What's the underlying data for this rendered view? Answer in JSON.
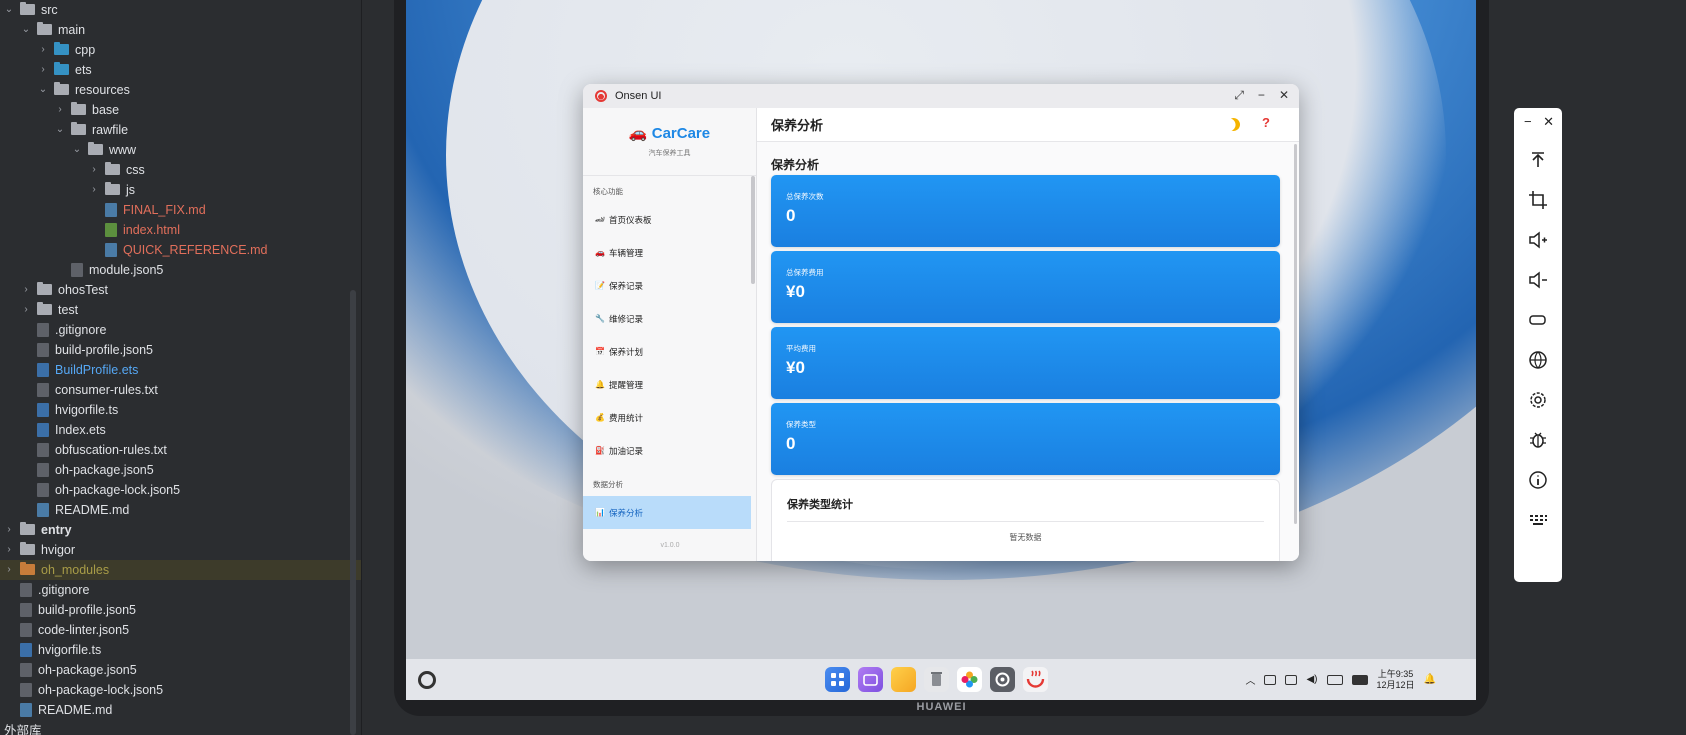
{
  "ide": {
    "tree": [
      {
        "label": "src",
        "type": "folder",
        "depth": 0,
        "open": true
      },
      {
        "label": "main",
        "type": "folder",
        "depth": 1,
        "open": true
      },
      {
        "label": "cpp",
        "type": "folder-blue",
        "depth": 2,
        "open": false
      },
      {
        "label": "ets",
        "type": "folder-blue",
        "depth": 2,
        "open": false
      },
      {
        "label": "resources",
        "type": "folder",
        "depth": 2,
        "open": true
      },
      {
        "label": "base",
        "type": "folder",
        "depth": 3,
        "open": false
      },
      {
        "label": "rawfile",
        "type": "folder",
        "depth": 3,
        "open": true
      },
      {
        "label": "www",
        "type": "folder",
        "depth": 4,
        "open": true
      },
      {
        "label": "css",
        "type": "folder",
        "depth": 5,
        "open": false
      },
      {
        "label": "js",
        "type": "folder",
        "depth": 5,
        "open": false
      },
      {
        "label": "FINAL_FIX.md",
        "type": "file-md",
        "depth": 5,
        "style": "red"
      },
      {
        "label": "index.html",
        "type": "file-html",
        "depth": 5,
        "style": "red"
      },
      {
        "label": "QUICK_REFERENCE.md",
        "type": "file-md",
        "depth": 5,
        "style": "red"
      },
      {
        "label": "module.json5",
        "type": "file",
        "depth": 3
      },
      {
        "label": "ohosTest",
        "type": "folder",
        "depth": 1,
        "open": false
      },
      {
        "label": "test",
        "type": "folder",
        "depth": 1,
        "open": false
      },
      {
        "label": ".gitignore",
        "type": "file",
        "depth": 1
      },
      {
        "label": "build-profile.json5",
        "type": "file",
        "depth": 1
      },
      {
        "label": "BuildProfile.ets",
        "type": "file-ts",
        "depth": 1,
        "style": "blue"
      },
      {
        "label": "consumer-rules.txt",
        "type": "file",
        "depth": 1
      },
      {
        "label": "hvigorfile.ts",
        "type": "file-ts",
        "depth": 1
      },
      {
        "label": "Index.ets",
        "type": "file-ts",
        "depth": 1
      },
      {
        "label": "obfuscation-rules.txt",
        "type": "file",
        "depth": 1
      },
      {
        "label": "oh-package.json5",
        "type": "file",
        "depth": 1
      },
      {
        "label": "oh-package-lock.json5",
        "type": "file",
        "depth": 1
      },
      {
        "label": "README.md",
        "type": "file-md",
        "depth": 1
      },
      {
        "label": "entry",
        "type": "folder",
        "depth": 0,
        "style": "bold"
      },
      {
        "label": "hvigor",
        "type": "folder",
        "depth": 0
      },
      {
        "label": "oh_modules",
        "type": "folder-orange",
        "depth": 0,
        "style": "olive",
        "highlight": true
      },
      {
        "label": ".gitignore",
        "type": "file",
        "depth": 0
      },
      {
        "label": "build-profile.json5",
        "type": "file",
        "depth": 0
      },
      {
        "label": "code-linter.json5",
        "type": "file",
        "depth": 0
      },
      {
        "label": "hvigorfile.ts",
        "type": "file-ts",
        "depth": 0
      },
      {
        "label": "oh-package.json5",
        "type": "file",
        "depth": 0
      },
      {
        "label": "oh-package-lock.json5",
        "type": "file",
        "depth": 0
      },
      {
        "label": "README.md",
        "type": "file-md",
        "depth": 0
      },
      {
        "label": "外部库",
        "type": "text",
        "depth": 0
      }
    ]
  },
  "device": {
    "brand": "HUAWEI",
    "clock": {
      "time": "上午9:35",
      "date": "12月12日"
    },
    "dock_icons": [
      "app-grid-icon",
      "multitask-icon",
      "files-icon",
      "trash-icon",
      "gallery-icon",
      "settings-icon",
      "onsen-app-icon"
    ],
    "tray_icons": [
      "chevron-up-icon",
      "input-method-icon",
      "keyboard-icon",
      "volume-icon",
      "display-icon",
      "battery-icon",
      "bell-icon"
    ]
  },
  "window": {
    "title": "Onsen UI"
  },
  "app": {
    "brand": "🚗 CarCare",
    "subtitle": "汽车保养工具",
    "sections": [
      {
        "label": "核心功能",
        "items": [
          {
            "icon": "🏎",
            "label": "首页仪表板"
          },
          {
            "icon": "🚗",
            "label": "车辆管理"
          },
          {
            "icon": "📝",
            "label": "保养记录"
          },
          {
            "icon": "🔧",
            "label": "维修记录"
          },
          {
            "icon": "📅",
            "label": "保养计划"
          },
          {
            "icon": "🔔",
            "label": "提醒管理"
          },
          {
            "icon": "💰",
            "label": "费用统计"
          },
          {
            "icon": "⛽",
            "label": "加油记录"
          }
        ]
      },
      {
        "label": "数据分析",
        "items": [
          {
            "icon": "📊",
            "label": "保养分析",
            "active": true
          }
        ]
      }
    ],
    "version": "v1.0.0",
    "page_title": "保养分析",
    "section_title": "保养分析",
    "stats": [
      {
        "label": "总保养次数",
        "value": "0"
      },
      {
        "label": "总保养费用",
        "value": "¥0"
      },
      {
        "label": "平均费用",
        "value": "¥0"
      },
      {
        "label": "保养类型",
        "value": "0"
      }
    ],
    "type_card": {
      "title": "保养类型统计",
      "empty": "暂无数据"
    },
    "header_icons": [
      "moon-icon",
      "help-icon"
    ],
    "colors": {
      "accent": "#1e88e5",
      "card": "#2196f3",
      "active_bg": "#b9dcfa",
      "help": "#e53935",
      "moon": "#f5b400"
    }
  },
  "emulator_tools": [
    "minimize-icon",
    "close-icon",
    "upload-icon",
    "crop-icon",
    "volume-up-icon",
    "volume-down-icon",
    "power-icon",
    "globe-icon",
    "settings-icon",
    "bug-icon",
    "info-icon",
    "keyboard-icon"
  ]
}
